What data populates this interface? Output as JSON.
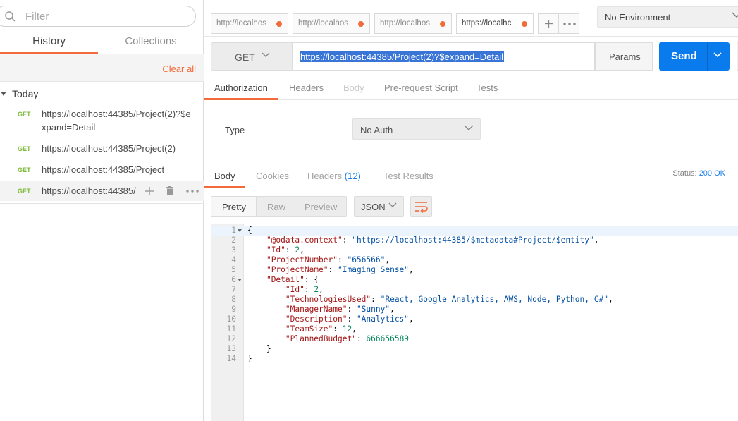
{
  "sidebar": {
    "filter_placeholder": "Filter",
    "tabs": {
      "history": "History",
      "collections": "Collections"
    },
    "clear_all": "Clear all",
    "group_label": "Today",
    "items": [
      {
        "method": "GET",
        "url_line1": "https://localhost:44385/Project(2)?$e",
        "url_line2": "xpand=Detail"
      },
      {
        "method": "GET",
        "url": "https://localhost:44385/Project(2)"
      },
      {
        "method": "GET",
        "url": "https://localhost:44385/Project"
      },
      {
        "method": "GET",
        "url": "https://localhost:44385/"
      }
    ]
  },
  "tabs": [
    {
      "title": "http://localhos"
    },
    {
      "title": "http://localhos"
    },
    {
      "title": "http://localhos"
    },
    {
      "title": "https://localhc"
    }
  ],
  "environment": "No Environment",
  "request": {
    "method": "GET",
    "url": "https://localhost:44385/Project(2)?$expand=Detail",
    "params_label": "Params",
    "send_label": "Send"
  },
  "request_tabs": [
    "Authorization",
    "Headers",
    "Body",
    "Pre-request Script",
    "Tests"
  ],
  "auth": {
    "type_label": "Type",
    "value": "No Auth"
  },
  "response": {
    "tabs": {
      "body": "Body",
      "cookies": "Cookies",
      "headers": "Headers",
      "headers_count": "(12)",
      "test_results": "Test Results"
    },
    "status_label": "Status:",
    "status_value": "200 OK",
    "view_modes": [
      "Pretty",
      "Raw",
      "Preview"
    ],
    "format": "JSON"
  },
  "code_lines": [
    {
      "n": "1",
      "text": "{"
    },
    {
      "n": "2",
      "key": "\"@odata.context\"",
      "sep": ": ",
      "str": "\"https://localhost:44385/$metadata#Project/$entity\"",
      "tail": ",",
      "indent": "    "
    },
    {
      "n": "3",
      "key": "\"Id\"",
      "sep": ": ",
      "num": "2",
      "tail": ",",
      "indent": "    "
    },
    {
      "n": "4",
      "key": "\"ProjectNumber\"",
      "sep": ": ",
      "str": "\"656566\"",
      "tail": ",",
      "indent": "    "
    },
    {
      "n": "5",
      "key": "\"ProjectName\"",
      "sep": ": ",
      "str": "\"Imaging Sense\"",
      "tail": ",",
      "indent": "    "
    },
    {
      "n": "6",
      "key": "\"Detail\"",
      "sep": ": ",
      "tail": "{",
      "indent": "    "
    },
    {
      "n": "7",
      "key": "\"Id\"",
      "sep": ": ",
      "num": "2",
      "tail": ",",
      "indent": "        "
    },
    {
      "n": "8",
      "key": "\"TechnologiesUsed\"",
      "sep": ": ",
      "str": "\"React, Google Analytics, AWS, Node, Python, C#\"",
      "tail": ",",
      "indent": "        "
    },
    {
      "n": "9",
      "key": "\"ManagerName\"",
      "sep": ": ",
      "str": "\"Sunny\"",
      "tail": ",",
      "indent": "        "
    },
    {
      "n": "10",
      "key": "\"Description\"",
      "sep": ": ",
      "str": "\"Analytics\"",
      "tail": ",",
      "indent": "        "
    },
    {
      "n": "11",
      "key": "\"TeamSize\"",
      "sep": ": ",
      "num": "12",
      "tail": ",",
      "indent": "        "
    },
    {
      "n": "12",
      "key": "\"PlannedBudget\"",
      "sep": ": ",
      "num": "666656589",
      "tail": "",
      "indent": "        "
    },
    {
      "n": "13",
      "text": "    }"
    },
    {
      "n": "14",
      "text": "}"
    }
  ],
  "colors": {
    "accent_orange": "#f26b3a",
    "send_blue": "#097bed",
    "get_green": "#7cbb38",
    "status_blue": "#1a7ee8",
    "selection_blue": "#3875d7"
  }
}
